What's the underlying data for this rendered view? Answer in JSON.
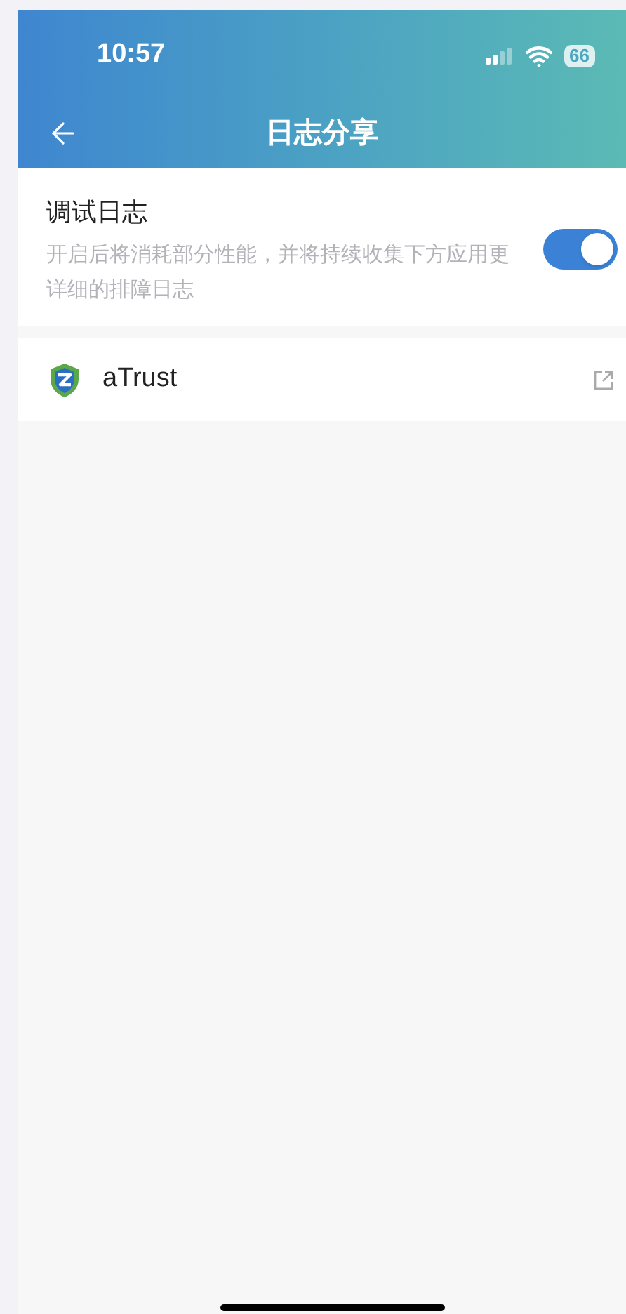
{
  "status_bar": {
    "time": "10:57",
    "battery": "66"
  },
  "nav": {
    "title": "日志分享"
  },
  "debug_setting": {
    "title": "调试日志",
    "description": "开启后将消耗部分性能，并将持续收集下方应用更详细的排障日志",
    "on": true
  },
  "apps": [
    {
      "name": "aTrust"
    }
  ]
}
